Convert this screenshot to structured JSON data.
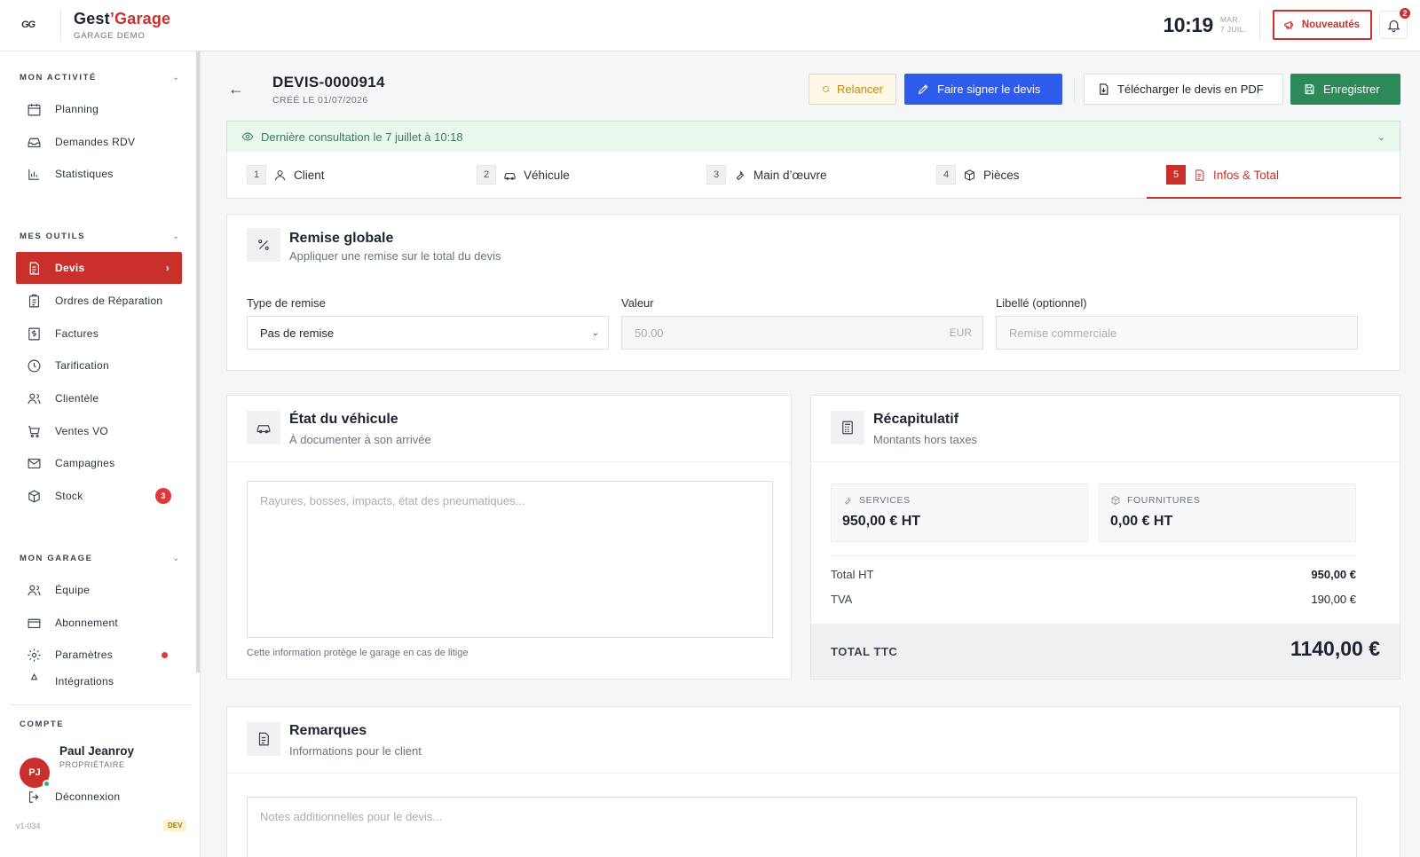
{
  "brand": {
    "logo_text": "GG",
    "name_part1": "Gest",
    "name_accent": "’Garage",
    "subtitle": "GARAGE DEMO"
  },
  "topbar": {
    "time": "10:19",
    "date_line1": "MAR.",
    "date_line2": "7 JUIL.",
    "news_label": "Nouveautés",
    "notif_count": "2"
  },
  "sidebar": {
    "sections": {
      "activity": "MON ACTIVITÉ",
      "tools": "MES OUTILS",
      "garage": "MON GARAGE",
      "account": "COMPTE"
    },
    "activity_items": [
      "Planning",
      "Demandes RDV",
      "Statistiques"
    ],
    "tools_items": [
      "Devis",
      "Ordres de Réparation",
      "Factures",
      "Tarification",
      "Clientèle",
      "Ventes VO",
      "Campagnes",
      "Stock"
    ],
    "stock_badge": "3",
    "garage_items": [
      "Équipe",
      "Abonnement",
      "Paramètres",
      "Intégrations"
    ],
    "user": {
      "initials": "PJ",
      "name": "Paul Jeanroy",
      "role": "PROPRIÉTAIRE"
    },
    "logout_label": "Déconnexion",
    "version": "v1-034",
    "env_badge": "DEV"
  },
  "header": {
    "title": "DEVIS-0000914",
    "created": "CRÉÉ LE 01/07/2026",
    "btn_relancer": "Relancer",
    "btn_signer": "Faire signer le devis",
    "btn_pdf": "Télécharger le devis en PDF",
    "btn_save": "Enregistrer"
  },
  "consultation": "Dernière consultation le 7 juillet à 10:18",
  "steps": [
    {
      "num": "1",
      "label": "Client"
    },
    {
      "num": "2",
      "label": "Véhicule"
    },
    {
      "num": "3",
      "label": "Main d’œuvre"
    },
    {
      "num": "4",
      "label": "Pièces"
    },
    {
      "num": "5",
      "label": "Infos & Total"
    }
  ],
  "remise": {
    "title": "Remise globale",
    "subtitle": "Appliquer une remise sur le total du devis",
    "type_label": "Type de remise",
    "type_value": "Pas de remise",
    "valeur_label": "Valeur",
    "valeur_placeholder": "50.00",
    "valeur_unit": "EUR",
    "libelle_label": "Libellé (optionnel)",
    "libelle_placeholder": "Remise commerciale"
  },
  "etat": {
    "title": "État du véhicule",
    "subtitle": "À documenter à son arrivée",
    "placeholder": "Rayures, bosses, impacts, état des pneumatiques...",
    "help": "Cette information protège le garage en cas de litige"
  },
  "recap": {
    "title": "Récapitulatif",
    "subtitle": "Montants hors taxes",
    "services_label": "SERVICES",
    "services_value": "950,00 € HT",
    "fournitures_label": "FOURNITURES",
    "fournitures_value": "0,00 € HT",
    "total_ht_label": "Total HT",
    "total_ht_value": "950,00 €",
    "tva_label": "TVA",
    "tva_value": "190,00 €",
    "ttc_label": "TOTAL TTC",
    "ttc_value": "1140,00 €"
  },
  "remarques": {
    "title": "Remarques",
    "subtitle": "Informations pour le client",
    "placeholder": "Notes additionnelles pour le devis..."
  },
  "colors": {
    "brand_red": "#c9302c",
    "blue": "#2f5bea",
    "green": "#2c8a5a",
    "amber": "#c08a10"
  }
}
